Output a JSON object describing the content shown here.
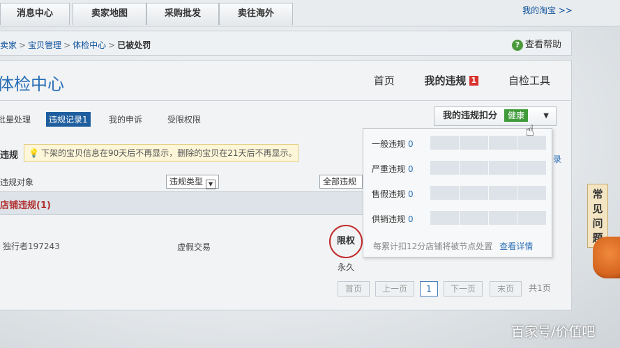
{
  "topnav": {
    "tabs": [
      {
        "label": "消息中心"
      },
      {
        "label": "卖家地图"
      },
      {
        "label": "采购批发"
      },
      {
        "label": "卖往海外"
      }
    ],
    "my_taobao": "我的淘宝 >>"
  },
  "breadcrumb": {
    "items": [
      "卖家",
      "宝贝管理",
      "体检中心"
    ],
    "current": "已被处罚"
  },
  "help": {
    "icon": "question-icon",
    "label": "查看帮助"
  },
  "page_title": "体检中心",
  "mainnav": {
    "home": "首页",
    "my_violations": "我的违规",
    "violations_badge": "1",
    "self_check": "自检工具"
  },
  "subtabs": {
    "batch": "批量处理",
    "records": "违规记录1",
    "appeals": "我的申诉",
    "restricted": "受限权限"
  },
  "deduct": {
    "label": "我的违规扣分",
    "status": "健康"
  },
  "notice": {
    "label": "违规",
    "icon": "lightbulb-icon",
    "text": "下架的宝贝信息在90天后不再显示，删除的宝贝在21天后不再显示。"
  },
  "table": {
    "col_object": "违规对象",
    "type_select": "违规类型",
    "all_select": "全部违规",
    "section": "店铺违规(1)",
    "rows": [
      {
        "who": "独行者197243",
        "type": "虚假交易",
        "penalty": "限权",
        "duration": "永久"
      }
    ]
  },
  "popup": {
    "rows": [
      {
        "label": "一般违规",
        "score": "0"
      },
      {
        "label": "严重违规",
        "score": "0"
      },
      {
        "label": "售假违规",
        "score": "0"
      },
      {
        "label": "供销违规",
        "score": "0"
      }
    ],
    "note": "每累计扣12分店铺将被节点处置",
    "more": "查看详情"
  },
  "right_edge_text": "录",
  "pager": {
    "first": "首页",
    "prev": "上一页",
    "current": "1",
    "next": "下一页",
    "last": "末页",
    "total": "共1页"
  },
  "faq": {
    "line1": "常",
    "line2": "见",
    "line3": "问",
    "line4": "题"
  },
  "watermark": "百家号/价值吧"
}
